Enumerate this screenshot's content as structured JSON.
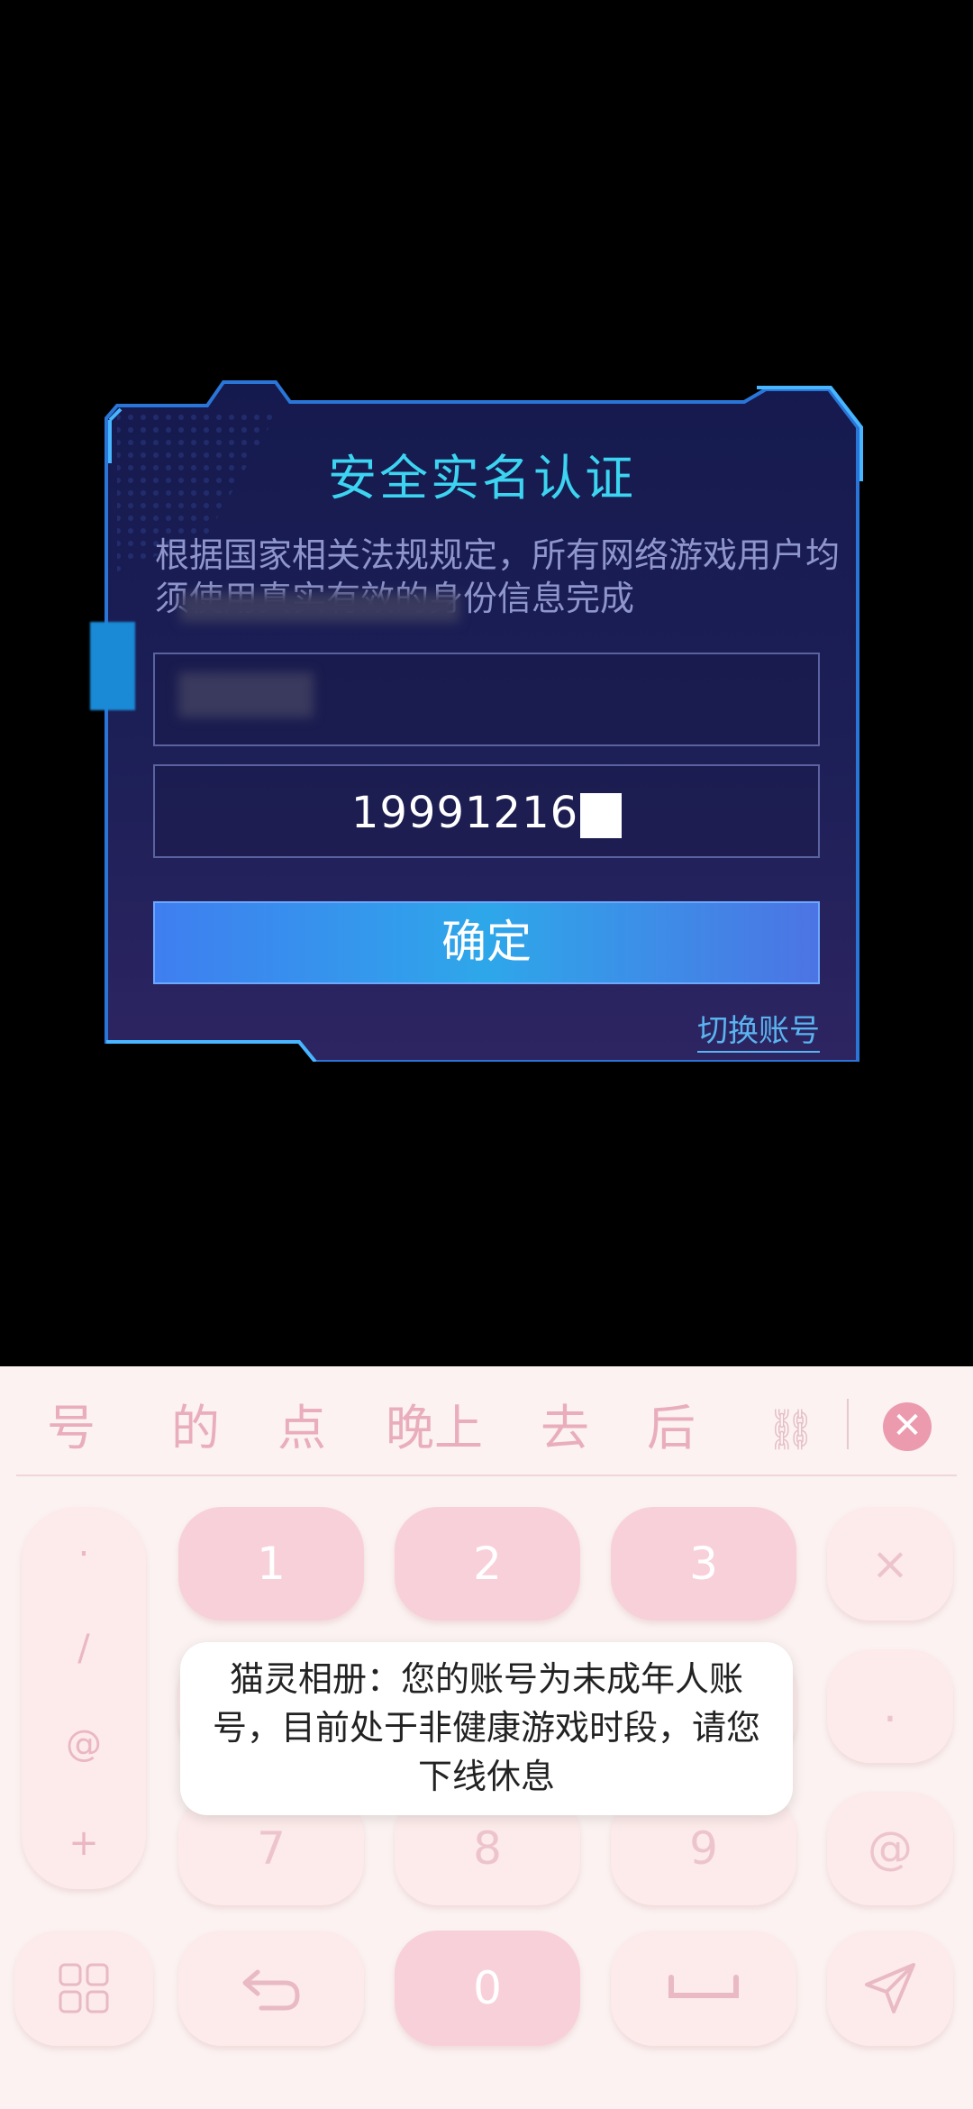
{
  "dialog": {
    "title": "安全实名认证",
    "description": "根据国家相关法规规定，所有网络游戏用户均须使用真实有效的身份信息完成",
    "id_field_value": "19991216",
    "confirm_label": "确定",
    "switch_account_label": "切换账号"
  },
  "keyboard": {
    "candidates": [
      "号",
      "的",
      "点",
      "晚上",
      "去",
      "后"
    ],
    "digits": [
      "1",
      "2",
      "3",
      "7",
      "8",
      "9",
      "0"
    ],
    "symbols": [
      ".",
      "/",
      "@",
      "+"
    ],
    "right_keys": [
      "×",
      ".",
      "@"
    ],
    "close_glyph": "✕",
    "link_glyph": "⛓"
  },
  "toast": {
    "message": "猫灵相册：您的账号为未成年人账号，目前处于非健康游戏时段，请您下线休息"
  },
  "colors": {
    "title_cyan": "#3cd4f0",
    "button_blue": "#2ea7ea",
    "keyboard_bg": "#fbf2f1",
    "key_pink": "#f8d0d9"
  }
}
